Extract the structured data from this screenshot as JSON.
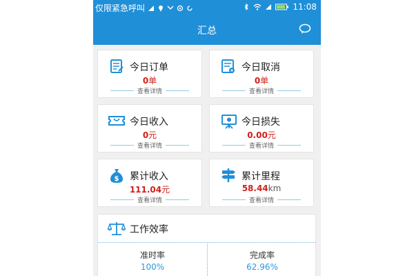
{
  "status_bar": {
    "carrier": "仅限紧急呼叫",
    "time": "11:08"
  },
  "header": {
    "title": "汇总",
    "message_icon": "chat-bubble-icon"
  },
  "cards": [
    {
      "icon": "order-document-icon",
      "title": "今日订单",
      "value": "0",
      "unit": "单",
      "detail": "查看详情"
    },
    {
      "icon": "cancel-document-icon",
      "title": "今日取消",
      "value": "0",
      "unit": "单",
      "detail": "查看详情"
    },
    {
      "icon": "ticket-income-icon",
      "title": "今日收入",
      "value": "0",
      "unit": "元",
      "detail": "查看详情"
    },
    {
      "icon": "chart-board-loss-icon",
      "title": "今日损失",
      "value": "0.00",
      "unit": "元",
      "detail": "查看详情"
    },
    {
      "icon": "money-bag-icon",
      "title": "累计收入",
      "value": "111.04",
      "unit": "元",
      "detail": "查看详情"
    },
    {
      "icon": "signpost-icon",
      "title": "累计里程",
      "value": "58.44",
      "unit": "km",
      "detail": "查看详情"
    }
  ],
  "efficiency": {
    "title": "工作效率",
    "icon": "balance-scale-icon",
    "items": [
      {
        "label": "准时率",
        "value": "100%"
      },
      {
        "label": "完成率",
        "value": "62.96%"
      }
    ]
  },
  "colors": {
    "primary": "#1f8fd8",
    "value_red": "#d0201b",
    "percent_blue": "#2a9ad8",
    "background": "#f0f0f0"
  }
}
